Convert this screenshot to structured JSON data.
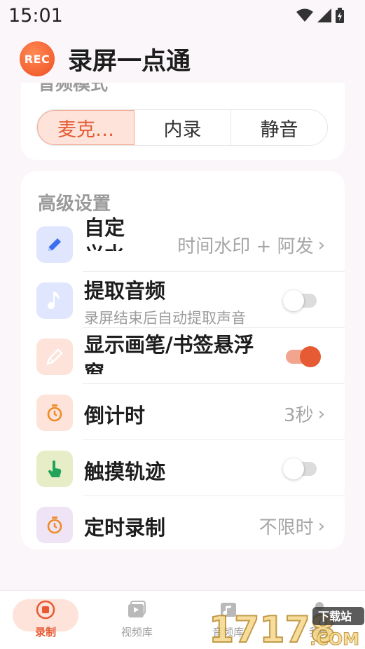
{
  "status_bar": {
    "time": "15:01"
  },
  "header": {
    "logo_text": "REC",
    "title": "录屏一点通"
  },
  "audio_mode": {
    "title": "音频模式",
    "options": [
      "麦克…",
      "内录",
      "静音"
    ],
    "selected_index": 0
  },
  "advanced": {
    "title": "高级设置",
    "rows": [
      {
        "label": "自定义水印",
        "value": "时间水印 + 阿发"
      },
      {
        "label": "提取音频",
        "sublabel": "录屏结束后自动提取声音",
        "toggle_on": false
      },
      {
        "label": "显示画笔/书签悬浮窗",
        "toggle_on": true
      },
      {
        "label": "倒计时",
        "value": "3秒"
      },
      {
        "label": "触摸轨迹",
        "toggle_on": false
      },
      {
        "label": "定时录制",
        "value": "不限时"
      }
    ],
    "chevron": "›"
  },
  "bottom_nav": {
    "items": [
      {
        "label": "录制",
        "icon": "record-icon"
      },
      {
        "label": "视频库",
        "icon": "video-library-icon"
      },
      {
        "label": "音频库",
        "icon": "audio-library-icon"
      },
      {
        "label": "我的",
        "icon": "profile-icon"
      }
    ],
    "active_index": 0
  },
  "watermark": {
    "text_main": "17178",
    "text_tag": "下载站",
    "text_com": ".COM"
  },
  "colors": {
    "accent": "#e65a34",
    "accent_light": "#fde3d9",
    "background": "#fbf6f9"
  }
}
